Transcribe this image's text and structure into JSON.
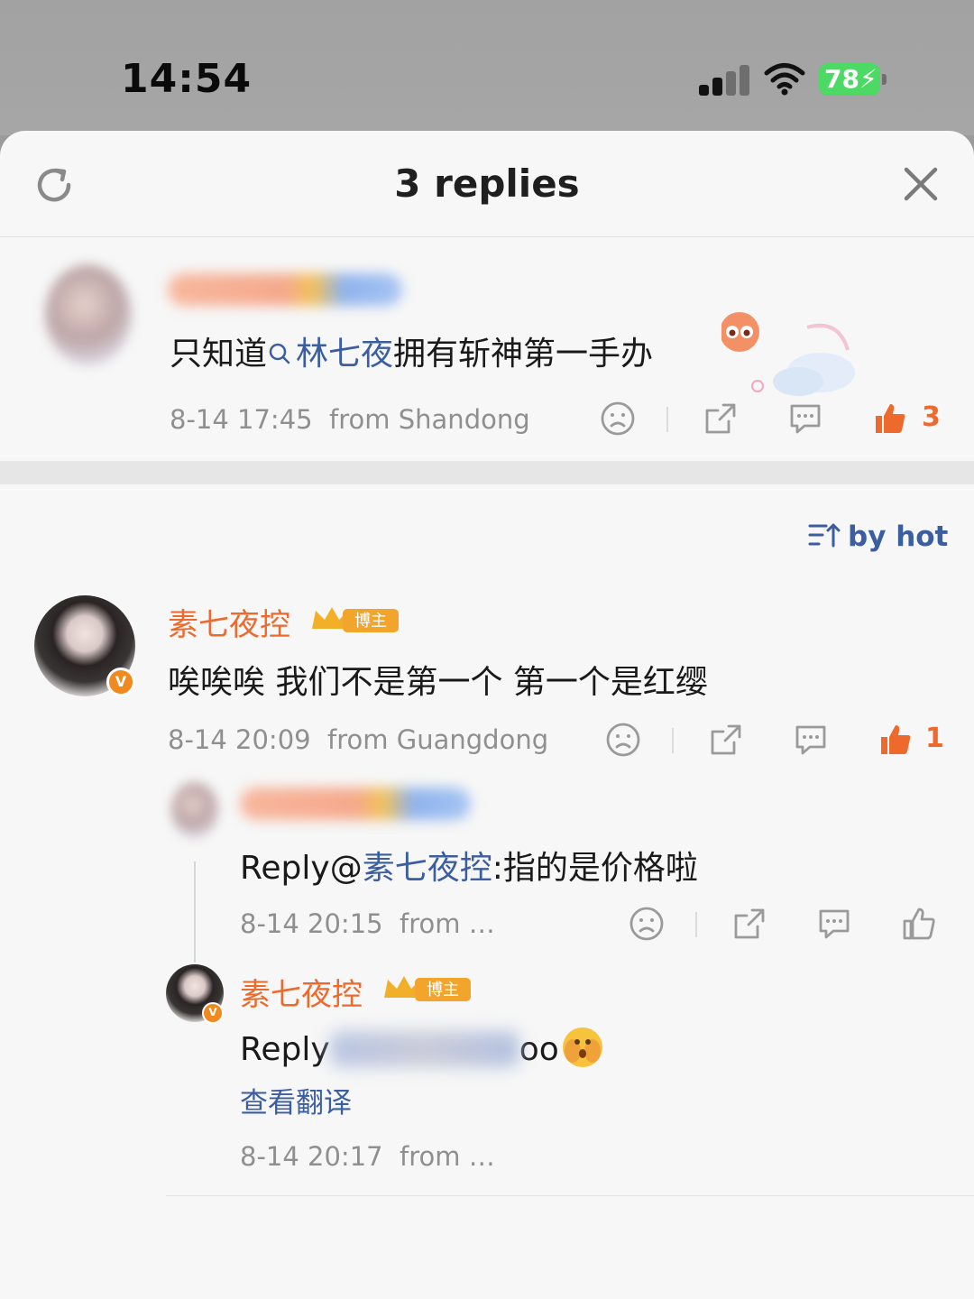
{
  "status_bar": {
    "time": "14:54",
    "battery": "78"
  },
  "header": {
    "title": "3 replies",
    "refresh_icon": "refresh-icon",
    "close_icon": "close-icon"
  },
  "original_comment": {
    "text_before": "只知道",
    "topic_link": "林七夜",
    "text_after": "拥有斩神第一手办",
    "timestamp": "8-14 17:45",
    "location": "from Shandong",
    "like_count": "3"
  },
  "sort": {
    "label": "by hot"
  },
  "comments": [
    {
      "author": "素七夜控",
      "badge": "博主",
      "text": "唉唉唉 我们不是第一个 第一个是红缨",
      "timestamp": "8-14 20:09",
      "location": "from Guangdong",
      "like_count": "1"
    }
  ],
  "replies": [
    {
      "prefix": "Reply@",
      "mention": "素七夜控",
      "text": ":指的是价格啦",
      "timestamp": "8-14 20:15",
      "location": "from …"
    },
    {
      "author": "素七夜控",
      "badge": "博主",
      "prefix": "Reply",
      "text_end": "oo",
      "translate_label": "查看翻译",
      "timestamp": "8-14 20:17",
      "location": "from …"
    }
  ],
  "colors": {
    "accent_orange": "#ee6a2c",
    "link_blue": "#3b5ea0",
    "meta_gray": "#8f8f8f"
  }
}
